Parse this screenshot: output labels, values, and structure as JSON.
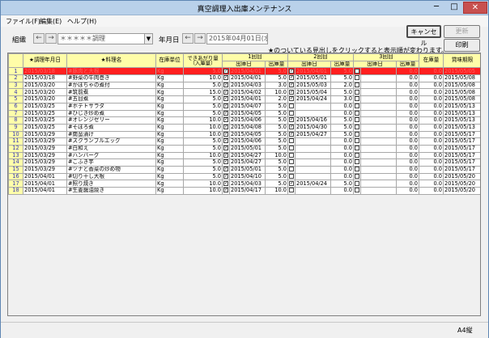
{
  "window": {
    "title": "真空調理入出庫メンテナンス",
    "minimize": "─",
    "maximize": "□",
    "close": "✕"
  },
  "menu": {
    "file": "ファイル(F)",
    "edit": "編集(E)",
    "help": "ヘルプ(H)"
  },
  "toolbar": {
    "org_label": "組織",
    "org_value": "＊＊＊＊＊調理",
    "yearmonth_label": "年月日",
    "date_value": "2015年04月01日(水)",
    "prev": "←",
    "next": "→",
    "dropdown": "▼",
    "cancel_label": "キャンセル",
    "update_label": "更新",
    "print_label": "印刷",
    "hint": "★のついている見出しをクリックすると表示順が変わります。"
  },
  "grid": {
    "headers": {
      "date": "★調理年月日",
      "name": "★料理名",
      "unit": "在庫単位",
      "yield": "できあがり量（入庫量）",
      "round1": "1回目",
      "round2": "2回目",
      "round3": "3回目",
      "outdate": "出庫日",
      "outqty": "出庫量",
      "stock": "在庫量",
      "expiry": "賞味期限"
    },
    "rows": [
      {
        "date": "2015/03/18",
        "name": "#豚肉と大根",
        "unit": "Kg",
        "yield": "5.0",
        "c1": true,
        "d1": "2015/04/01",
        "q1": "5.0",
        "c2": true,
        "d2": "2015/04/01",
        "q2": "5.0",
        "c3": false,
        "q3": "0.0",
        "stock": "0.0",
        "exp": "2015/05/05",
        "selected": true
      },
      {
        "date": "2015/03/18",
        "name": "#野菜の牛肉巻き",
        "unit": "Kg",
        "yield": "10.0",
        "c1": true,
        "d1": "2015/04/01",
        "q1": "5.0",
        "c2": true,
        "d2": "2015/05/01",
        "q2": "5.0",
        "c3": false,
        "q3": "0.0",
        "stock": "0.0",
        "exp": "2015/05/08"
      },
      {
        "date": "2015/03/20",
        "name": "#かぼちゃの煮付",
        "unit": "Kg",
        "yield": "5.0",
        "c1": true,
        "d1": "2015/04/03",
        "q1": "3.0",
        "c2": true,
        "d2": "2015/05/03",
        "q2": "2.0",
        "c3": false,
        "q3": "0.0",
        "stock": "0.0",
        "exp": "2015/05/08"
      },
      {
        "date": "2015/03/20",
        "name": "#筑前煮",
        "unit": "Kg",
        "yield": "15.0",
        "c1": true,
        "d1": "2015/04/02",
        "q1": "10.0",
        "c2": true,
        "d2": "2015/05/04",
        "q2": "5.0",
        "c3": false,
        "q3": "0.0",
        "stock": "0.0",
        "exp": "2015/05/08"
      },
      {
        "date": "2015/03/20",
        "name": "#五目煮",
        "unit": "Kg",
        "yield": "5.0",
        "c1": true,
        "d1": "2015/04/01",
        "q1": "2.0",
        "c2": true,
        "d2": "2015/04/24",
        "q2": "3.0",
        "c3": false,
        "q3": "0.0",
        "stock": "0.0",
        "exp": "2015/05/08"
      },
      {
        "date": "2015/03/25",
        "name": "#ポテトサラダ",
        "unit": "Kg",
        "yield": "5.0",
        "c1": true,
        "d1": "2015/04/07",
        "q1": "5.0",
        "c2": false,
        "d2": "",
        "q2": "0.0",
        "c3": false,
        "q3": "0.0",
        "stock": "0.0",
        "exp": "2015/05/13"
      },
      {
        "date": "2015/03/25",
        "name": "#ひじき炒め煮",
        "unit": "Kg",
        "yield": "5.0",
        "c1": true,
        "d1": "2015/04/05",
        "q1": "5.0",
        "c2": false,
        "d2": "",
        "q2": "0.0",
        "c3": false,
        "q3": "0.0",
        "stock": "0.0",
        "exp": "2015/05/13"
      },
      {
        "date": "2015/03/25",
        "name": "#オレンジゼリー",
        "unit": "Kg",
        "yield": "10.0",
        "c1": true,
        "d1": "2015/04/06",
        "q1": "5.0",
        "c2": true,
        "d2": "2015/04/16",
        "q2": "5.0",
        "c3": false,
        "q3": "0.0",
        "stock": "0.0",
        "exp": "2015/05/13"
      },
      {
        "date": "2015/03/25",
        "name": "#そぼろ煮",
        "unit": "Kg",
        "yield": "10.0",
        "c1": true,
        "d1": "2015/04/08",
        "q1": "5.0",
        "c2": true,
        "d2": "2015/04/30",
        "q2": "5.0",
        "c3": false,
        "q3": "0.0",
        "stock": "0.0",
        "exp": "2015/05/13"
      },
      {
        "date": "2015/03/29",
        "name": "#南蛮漬け",
        "unit": "Kg",
        "yield": "10.0",
        "c1": true,
        "d1": "2015/04/05",
        "q1": "5.0",
        "c2": true,
        "d2": "2015/04/27",
        "q2": "5.0",
        "c3": false,
        "q3": "0.0",
        "stock": "0.0",
        "exp": "2015/05/17"
      },
      {
        "date": "2015/03/29",
        "name": "#スクランブルエッグ",
        "unit": "Kg",
        "yield": "5.0",
        "c1": true,
        "d1": "2015/04/06",
        "q1": "5.0",
        "c2": false,
        "d2": "",
        "q2": "0.0",
        "c3": false,
        "q3": "0.0",
        "stock": "0.0",
        "exp": "2015/05/17"
      },
      {
        "date": "2015/03/29",
        "name": "#白和え",
        "unit": "Kg",
        "yield": "5.0",
        "c1": true,
        "d1": "2015/05/01",
        "q1": "5.0",
        "c2": false,
        "d2": "",
        "q2": "0.0",
        "c3": false,
        "q3": "0.0",
        "stock": "0.0",
        "exp": "2015/05/17"
      },
      {
        "date": "2015/03/29",
        "name": "#ハンバーグ",
        "unit": "Kg",
        "yield": "10.0",
        "c1": true,
        "d1": "2015/04/27",
        "q1": "10.0",
        "c2": false,
        "d2": "",
        "q2": "0.0",
        "c3": false,
        "q3": "0.0",
        "stock": "0.0",
        "exp": "2015/05/17"
      },
      {
        "date": "2015/03/29",
        "name": "#こふき芋",
        "unit": "Kg",
        "yield": "5.0",
        "c1": true,
        "d1": "2015/04/27",
        "q1": "5.0",
        "c2": false,
        "d2": "",
        "q2": "0.0",
        "c3": false,
        "q3": "0.0",
        "stock": "0.0",
        "exp": "2015/05/17"
      },
      {
        "date": "2015/03/29",
        "name": "#ツナと香菜の炒め物",
        "unit": "Kg",
        "yield": "5.0",
        "c1": true,
        "d1": "2015/05/01",
        "q1": "5.0",
        "c2": false,
        "d2": "",
        "q2": "0.0",
        "c3": false,
        "q3": "0.0",
        "stock": "0.0",
        "exp": "2015/05/17"
      },
      {
        "date": "2015/04/01",
        "name": "#切り干し大根",
        "unit": "Kg",
        "yield": "5.0",
        "c1": true,
        "d1": "2015/04/10",
        "q1": "5.0",
        "c2": false,
        "d2": "",
        "q2": "0.0",
        "c3": false,
        "q3": "0.0",
        "stock": "0.0",
        "exp": "2015/05/20"
      },
      {
        "date": "2015/04/01",
        "name": "#照り焼き",
        "unit": "Kg",
        "yield": "10.0",
        "c1": true,
        "d1": "2015/04/03",
        "q1": "5.0",
        "c2": true,
        "d2": "2015/04/24",
        "q2": "5.0",
        "c3": false,
        "q3": "0.0",
        "stock": "0.0",
        "exp": "2015/05/20"
      },
      {
        "date": "2015/04/01",
        "name": "#生姜醤油焼き",
        "unit": "Kg",
        "yield": "10.0",
        "c1": true,
        "d1": "2015/04/17",
        "q1": "10.0",
        "c2": false,
        "d2": "",
        "q2": "0.0",
        "c3": false,
        "q3": "0.0",
        "stock": "0.0",
        "exp": "2015/05/20"
      }
    ]
  },
  "status": {
    "paper": "A4縦"
  }
}
